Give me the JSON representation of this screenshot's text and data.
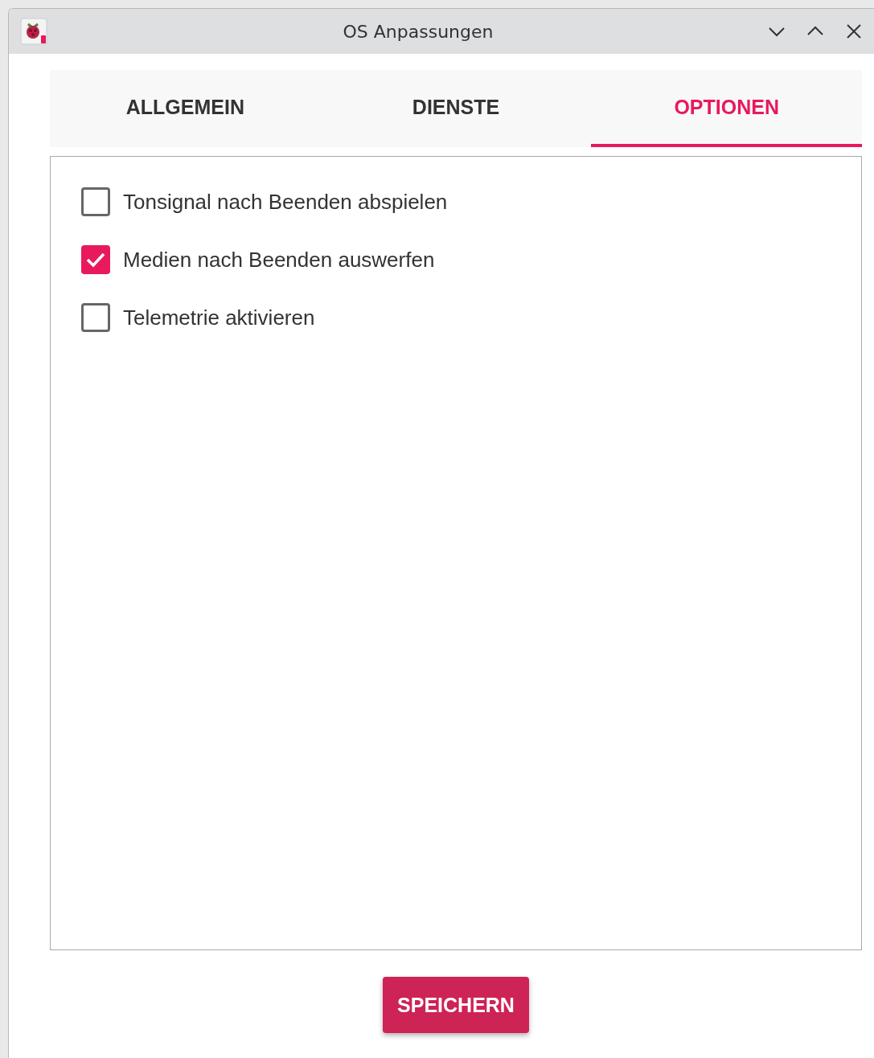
{
  "window": {
    "title": "OS Anpassungen"
  },
  "tabs": [
    {
      "label": "ALLGEMEIN",
      "selected": false
    },
    {
      "label": "DIENSTE",
      "selected": false
    },
    {
      "label": "OPTIONEN",
      "selected": true
    }
  ],
  "options": [
    {
      "label": "Tonsignal nach Beenden abspielen",
      "checked": false
    },
    {
      "label": "Medien nach Beenden auswerfen",
      "checked": true
    },
    {
      "label": "Telemetrie aktivieren",
      "checked": false
    }
  ],
  "save_button": "SPEICHERN"
}
